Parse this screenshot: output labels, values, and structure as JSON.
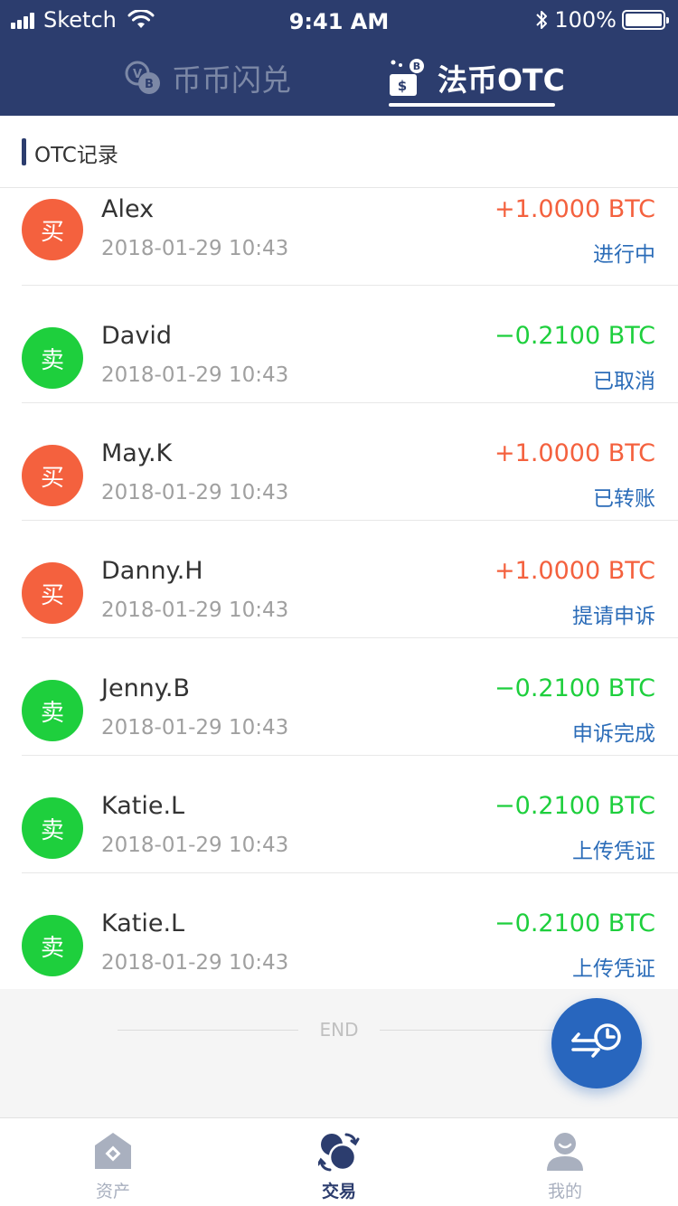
{
  "status_bar": {
    "carrier": "Sketch",
    "time": "9:41 AM",
    "battery": "100%"
  },
  "header": {
    "tabs": [
      {
        "label": "币币闪兑",
        "active": false,
        "icon": "coin-swap-icon"
      },
      {
        "label": "法币OTC",
        "active": true,
        "icon": "fiat-otc-icon"
      }
    ]
  },
  "section": {
    "title": "OTC记录"
  },
  "records": [
    {
      "type": "buy",
      "badge": "买",
      "name": "Alex",
      "time": "2018-01-29 10:43",
      "amount": "+1.0000 BTC",
      "status": "进行中"
    },
    {
      "type": "sell",
      "badge": "卖",
      "name": "David",
      "time": "2018-01-29 10:43",
      "amount": "−0.2100 BTC",
      "status": "已取消"
    },
    {
      "type": "buy",
      "badge": "买",
      "name": "May.K",
      "time": "2018-01-29 10:43",
      "amount": "+1.0000 BTC",
      "status": "已转账"
    },
    {
      "type": "buy",
      "badge": "买",
      "name": "Danny.H",
      "time": "2018-01-29 10:43",
      "amount": "+1.0000 BTC",
      "status": "提请申诉"
    },
    {
      "type": "sell",
      "badge": "卖",
      "name": "Jenny.B",
      "time": "2018-01-29 10:43",
      "amount": "−0.2100 BTC",
      "status": "申诉完成"
    },
    {
      "type": "sell",
      "badge": "卖",
      "name": "Katie.L",
      "time": "2018-01-29 10:43",
      "amount": "−0.2100 BTC",
      "status": "上传凭证"
    },
    {
      "type": "sell",
      "badge": "卖",
      "name": "Katie.L",
      "time": "2018-01-29 10:43",
      "amount": "−0.2100 BTC",
      "status": "上传凭证"
    }
  ],
  "end_text": "END",
  "fab": {
    "icon": "exchange-history-icon"
  },
  "tabbar": {
    "items": [
      {
        "label": "资产",
        "icon": "assets-icon",
        "active": false
      },
      {
        "label": "交易",
        "icon": "trade-icon",
        "active": true
      },
      {
        "label": "我的",
        "icon": "profile-icon",
        "active": false
      }
    ]
  },
  "colors": {
    "header_bg": "#2c3d6e",
    "buy": "#f4613e",
    "sell": "#1ecf3d",
    "status_text": "#2b6cb8",
    "fab_bg": "#2866be"
  }
}
